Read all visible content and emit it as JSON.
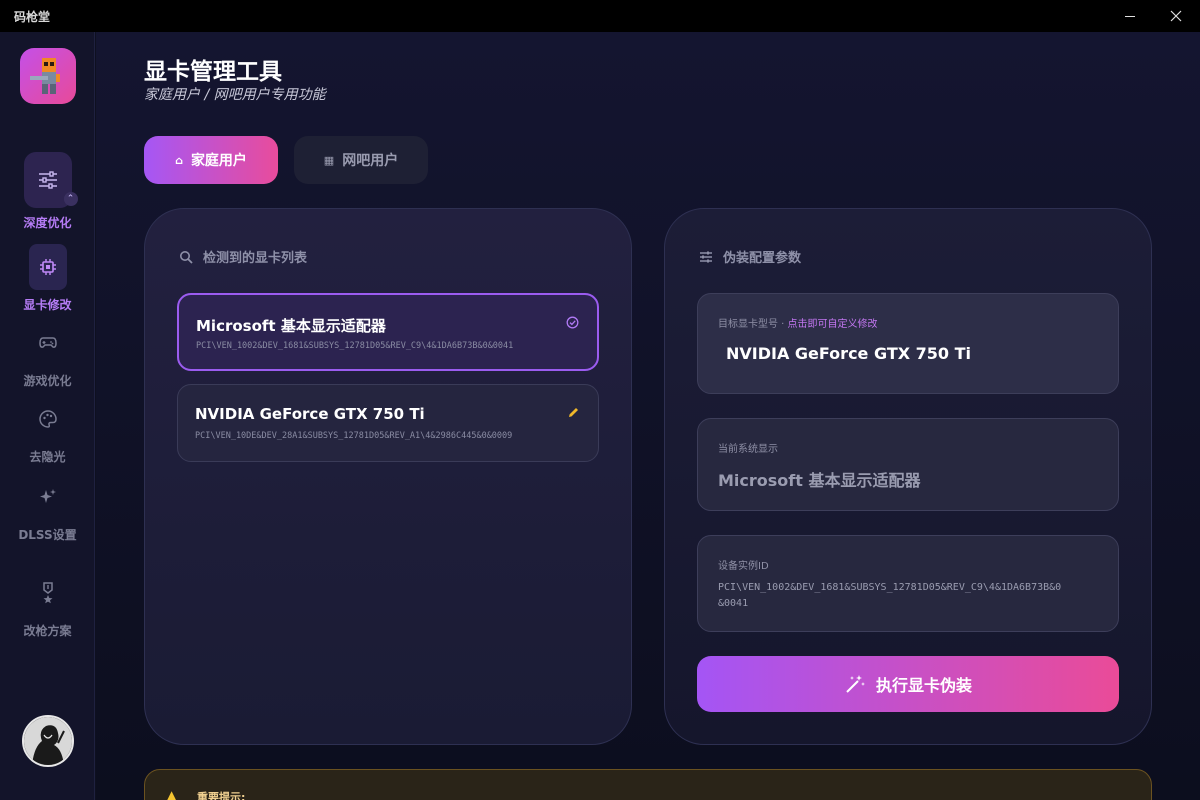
{
  "window": {
    "title": "码枪堂"
  },
  "sidebar": {
    "items": [
      {
        "label": "深度优化",
        "icon": "sliders-icon"
      },
      {
        "label": "显卡修改",
        "icon": "chip-icon"
      },
      {
        "label": "游戏优化",
        "icon": "gamepad-icon"
      },
      {
        "label": "去隐光",
        "icon": "palette-icon"
      },
      {
        "label": "DLSS设置",
        "icon": "sparkles-icon"
      },
      {
        "label": "改枪方案",
        "icon": "medal-icon"
      }
    ]
  },
  "header": {
    "title": "显卡管理工具",
    "subtitle": "家庭用户 / 网吧用户专用功能"
  },
  "tabs": [
    {
      "label": "家庭用户",
      "icon": "home-icon"
    },
    {
      "label": "网吧用户",
      "icon": "store-icon"
    }
  ],
  "gpu_panel": {
    "heading": "检测到的显卡列表",
    "gpus": [
      {
        "name": "Microsoft 基本显示适配器",
        "device_id": "PCI\\VEN_1002&DEV_1681&SUBSYS_12781D05&REV_C9\\4&1DA6B73B&0&0041"
      },
      {
        "name": "NVIDIA GeForce GTX 750 Ti",
        "device_id": "PCI\\VEN_10DE&DEV_28A1&SUBSYS_12781D05&REV_A1\\4&2986C445&0&0009"
      }
    ]
  },
  "config_panel": {
    "heading": "伪装配置参数",
    "target_label": "目标显卡型号 · ",
    "target_hint": "点击即可自定义修改",
    "target_value": "NVIDIA GeForce GTX 750 Ti",
    "current_label": "当前系统显示",
    "current_value": "Microsoft 基本显示适配器",
    "instance_label": "设备实例ID",
    "instance_line1": "PCI\\VEN_1002&DEV_1681&SUBSYS_12781D05&REV_C9\\4&1DA6B73B&0",
    "instance_line2": "&0041",
    "execute_label": "执行显卡伪装"
  },
  "notice": {
    "title": "重要提示:"
  },
  "colors": {
    "accent_purple": "#a557f5",
    "accent_pink": "#e84c9c",
    "warning": "#f4c430"
  }
}
